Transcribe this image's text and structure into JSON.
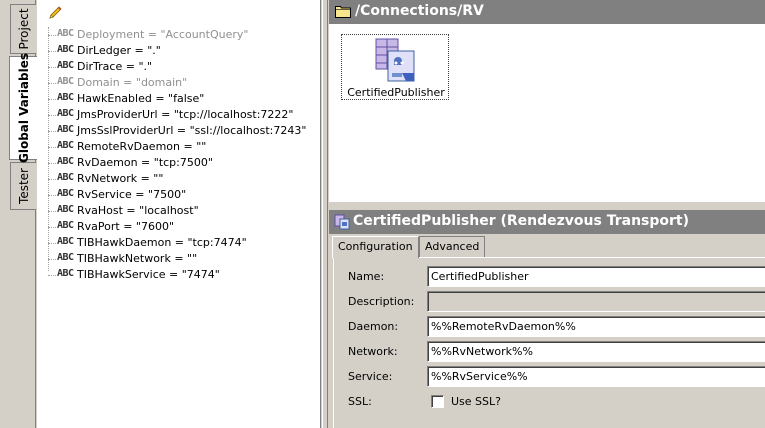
{
  "vertical_tabs": [
    {
      "label": "Project",
      "active": false
    },
    {
      "label": "Global Variables",
      "active": true
    },
    {
      "label": "Tester",
      "active": false
    }
  ],
  "tree": {
    "toolbar_icon": "pencil-icon",
    "type_icon_label": "ABC",
    "variables": [
      {
        "text": "Deployment = \"AccountQuery\"",
        "dim": true
      },
      {
        "text": "DirLedger = \".\"",
        "dim": false
      },
      {
        "text": "DirTrace = \".\"",
        "dim": false
      },
      {
        "text": "Domain = \"domain\"",
        "dim": true
      },
      {
        "text": "HawkEnabled = \"false\"",
        "dim": false
      },
      {
        "text": "JmsProviderUrl = \"tcp://localhost:7222\"",
        "dim": false
      },
      {
        "text": "JmsSslProviderUrl = \"ssl://localhost:7243\"",
        "dim": false
      },
      {
        "text": "RemoteRvDaemon = \"\"",
        "dim": false
      },
      {
        "text": "RvDaemon = \"tcp:7500\"",
        "dim": false
      },
      {
        "text": "RvNetwork = \"\"",
        "dim": false
      },
      {
        "text": "RvService = \"7500\"",
        "dim": false
      },
      {
        "text": "RvaHost = \"localhost\"",
        "dim": false
      },
      {
        "text": "RvaPort = \"7600\"",
        "dim": false
      },
      {
        "text": "TIBHawkDaemon = \"tcp:7474\"",
        "dim": false
      },
      {
        "text": "TIBHawkNetwork = \"\"",
        "dim": false
      },
      {
        "text": "TIBHawkService = \"7474\"",
        "dim": false
      }
    ]
  },
  "folder_panel": {
    "path": "/Connections/RV",
    "resources": [
      {
        "label": "CertifiedPublisher",
        "icon": "rv-transport-icon"
      }
    ]
  },
  "properties": {
    "title": "CertifiedPublisher (Rendezvous Transport)",
    "tabs": [
      {
        "label": "Configuration",
        "active": true
      },
      {
        "label": "Advanced",
        "active": false
      }
    ],
    "fields": {
      "name_label": "Name:",
      "name_value": "CertifiedPublisher",
      "description_label": "Description:",
      "description_value": "",
      "daemon_label": "Daemon:",
      "daemon_value": "%%RemoteRvDaemon%%",
      "network_label": "Network:",
      "network_value": "%%RvNetwork%%",
      "service_label": "Service:",
      "service_value": "%%RvService%%",
      "ssl_label": "SSL:",
      "ssl_checkbox_label": "Use SSL?",
      "ssl_checked": false
    }
  },
  "colors": {
    "header_bg": "#808080",
    "chrome_bg": "#d4d0c8",
    "dim_text": "#909090"
  }
}
